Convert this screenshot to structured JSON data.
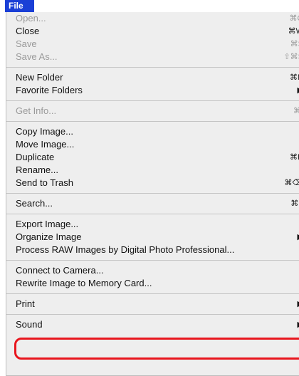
{
  "menubar": {
    "title": "File"
  },
  "menu": {
    "sections": [
      [
        {
          "label": "Open...",
          "shortcut": "⌘O",
          "disabled": true
        },
        {
          "label": "Close",
          "shortcut": "⌘W",
          "disabled": false
        },
        {
          "label": "Save",
          "shortcut": "⌘S",
          "disabled": true
        },
        {
          "label": "Save As...",
          "shortcut": "⇧⌘S",
          "disabled": true
        }
      ],
      [
        {
          "label": "New Folder",
          "shortcut": "⌘N",
          "disabled": false
        },
        {
          "label": "Favorite Folders",
          "shortcut": "▶",
          "disabled": false
        }
      ],
      [
        {
          "label": "Get Info...",
          "shortcut": "⌘I",
          "disabled": true
        }
      ],
      [
        {
          "label": "Copy Image...",
          "shortcut": "",
          "disabled": false
        },
        {
          "label": "Move Image...",
          "shortcut": "",
          "disabled": false
        },
        {
          "label": "Duplicate",
          "shortcut": "⌘D",
          "disabled": false
        },
        {
          "label": "Rename...",
          "shortcut": "",
          "disabled": false
        },
        {
          "label": "Send to Trash",
          "shortcut": "⌘⌫",
          "disabled": false
        }
      ],
      [
        {
          "label": "Search...",
          "shortcut": "⌘F",
          "disabled": false
        }
      ],
      [
        {
          "label": "Export Image...",
          "shortcut": "",
          "disabled": false,
          "highlighted": true
        },
        {
          "label": "Organize Image",
          "shortcut": "▶",
          "disabled": false
        },
        {
          "label": "Process RAW Images by Digital Photo Professional...",
          "shortcut": "",
          "disabled": false
        }
      ],
      [
        {
          "label": "Connect to Camera...",
          "shortcut": "",
          "disabled": false
        },
        {
          "label": "Rewrite Image to Memory Card...",
          "shortcut": "",
          "disabled": false
        }
      ],
      [
        {
          "label": "Print",
          "shortcut": "▶",
          "disabled": false
        }
      ],
      [
        {
          "label": "Sound",
          "shortcut": "▶",
          "disabled": false
        }
      ]
    ]
  },
  "highlight": {
    "color": "#e8161e",
    "target": "Export Image..."
  }
}
